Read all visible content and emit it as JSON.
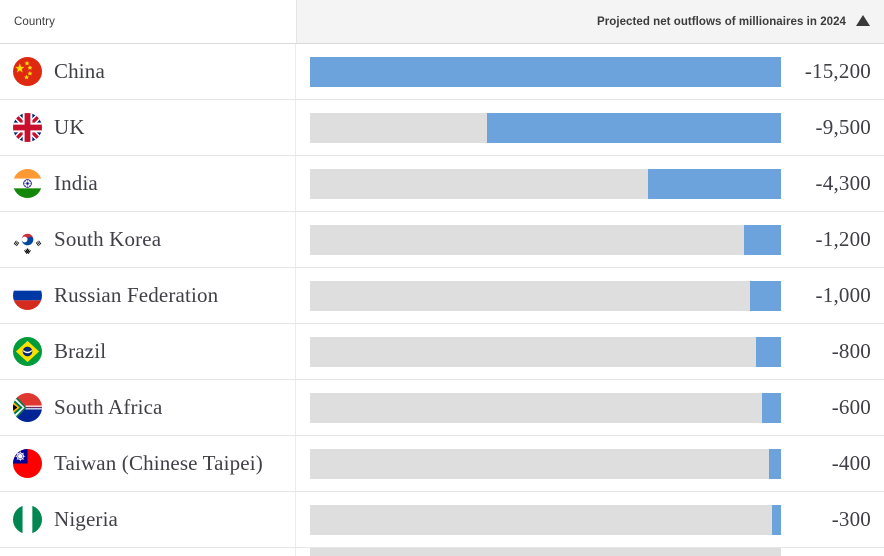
{
  "header": {
    "country_label": "Country",
    "metric_label": "Projected net outflows of millionaires in 2024",
    "sort_indicator": "sort-ascending-caret-icon"
  },
  "colors": {
    "bar_fill": "#6ca3dc",
    "bar_track": "#dedede",
    "header_background": "#f4f4f4",
    "text": "#3f3f46",
    "row_divider": "#e6e6e6"
  },
  "chart_data": {
    "type": "bar",
    "title": "Projected net outflows of millionaires in 2024",
    "xlabel": "",
    "ylabel": "Country",
    "categories": [
      "China",
      "UK",
      "India",
      "South Korea",
      "Russian Federation",
      "Brazil",
      "South Africa",
      "Taiwan (Chinese Taipei)",
      "Nigeria"
    ],
    "values": [
      -15200,
      -9500,
      -4300,
      -1200,
      -1000,
      -800,
      -600,
      -400,
      -300
    ],
    "value_labels": [
      "-15,200",
      "-9,500",
      "-4,300",
      "-1,200",
      "-1,000",
      "-800",
      "-600",
      "-400",
      "-300"
    ],
    "xlim": [
      -15200,
      0
    ],
    "orientation": "horizontal",
    "bar_anchor": "right",
    "grid": false,
    "legend": false,
    "sorted": "descending by magnitude"
  },
  "rows": [
    {
      "country": "China",
      "flag": "flag-china",
      "value_label": "-15,200",
      "value": -15200,
      "bar_pct": 100.0
    },
    {
      "country": "UK",
      "flag": "flag-uk",
      "value_label": "-9,500",
      "value": -9500,
      "bar_pct": 62.5
    },
    {
      "country": "India",
      "flag": "flag-india",
      "value_label": "-4,300",
      "value": -4300,
      "bar_pct": 28.3
    },
    {
      "country": "South Korea",
      "flag": "flag-south-korea",
      "value_label": "-1,200",
      "value": -1200,
      "bar_pct": 7.9
    },
    {
      "country": "Russian Federation",
      "flag": "flag-russia",
      "value_label": "-1,000",
      "value": -1000,
      "bar_pct": 6.6
    },
    {
      "country": "Brazil",
      "flag": "flag-brazil",
      "value_label": "-800",
      "value": -800,
      "bar_pct": 5.3
    },
    {
      "country": "South Africa",
      "flag": "flag-south-africa",
      "value_label": "-600",
      "value": -600,
      "bar_pct": 4.0
    },
    {
      "country": "Taiwan (Chinese Taipei)",
      "flag": "flag-taiwan",
      "value_label": "-400",
      "value": -400,
      "bar_pct": 2.6
    },
    {
      "country": "Nigeria",
      "flag": "flag-nigeria",
      "value_label": "-300",
      "value": -300,
      "bar_pct": 2.0
    }
  ]
}
